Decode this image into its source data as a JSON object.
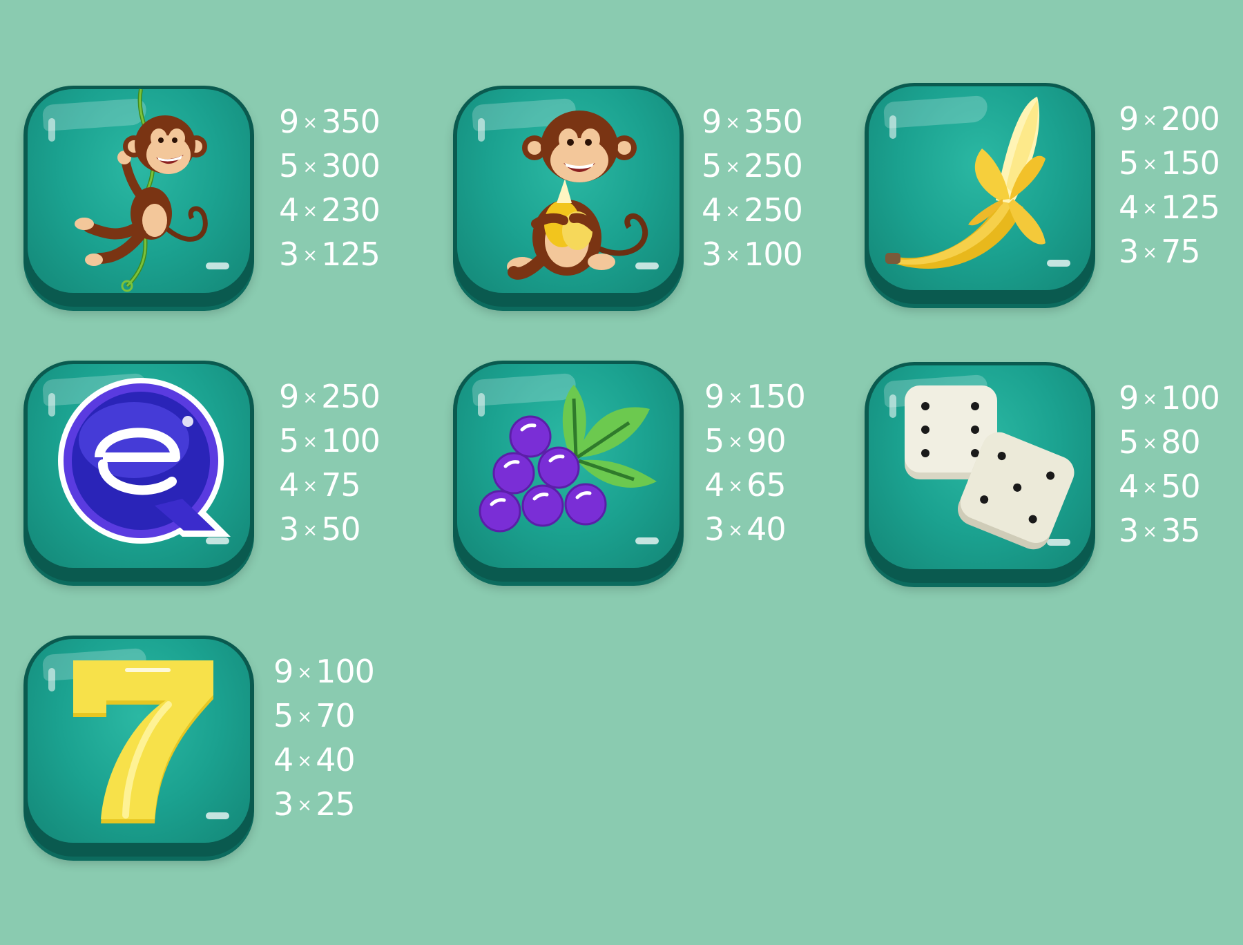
{
  "colors": {
    "background": "#8acbb0",
    "tile_face": "#1ba290",
    "tile_edge": "#0a5a4f",
    "text": "#ffffff"
  },
  "multiply_sign": "×",
  "symbols": [
    {
      "icon": "swinging-monkey-icon",
      "pays": [
        {
          "count": "9",
          "amount": "350"
        },
        {
          "count": "5",
          "amount": "300"
        },
        {
          "count": "4",
          "amount": "230"
        },
        {
          "count": "3",
          "amount": "125"
        }
      ]
    },
    {
      "icon": "banana-eating-monkey-icon",
      "pays": [
        {
          "count": "9",
          "amount": "350"
        },
        {
          "count": "5",
          "amount": "250"
        },
        {
          "count": "4",
          "amount": "250"
        },
        {
          "count": "3",
          "amount": "100"
        }
      ]
    },
    {
      "icon": "banana-icon",
      "pays": [
        {
          "count": "9",
          "amount": "200"
        },
        {
          "count": "5",
          "amount": "150"
        },
        {
          "count": "4",
          "amount": "125"
        },
        {
          "count": "3",
          "amount": "75"
        }
      ]
    },
    {
      "icon": "letter-q-icon",
      "pays": [
        {
          "count": "9",
          "amount": "250"
        },
        {
          "count": "5",
          "amount": "100"
        },
        {
          "count": "4",
          "amount": "75"
        },
        {
          "count": "3",
          "amount": "50"
        }
      ]
    },
    {
      "icon": "grapes-icon",
      "pays": [
        {
          "count": "9",
          "amount": "150"
        },
        {
          "count": "5",
          "amount": "90"
        },
        {
          "count": "4",
          "amount": "65"
        },
        {
          "count": "3",
          "amount": "40"
        }
      ]
    },
    {
      "icon": "dice-icon",
      "pays": [
        {
          "count": "9",
          "amount": "100"
        },
        {
          "count": "5",
          "amount": "80"
        },
        {
          "count": "4",
          "amount": "50"
        },
        {
          "count": "3",
          "amount": "35"
        }
      ]
    },
    {
      "icon": "seven-icon",
      "pays": [
        {
          "count": "9",
          "amount": "100"
        },
        {
          "count": "5",
          "amount": "70"
        },
        {
          "count": "4",
          "amount": "40"
        },
        {
          "count": "3",
          "amount": "25"
        }
      ]
    }
  ]
}
